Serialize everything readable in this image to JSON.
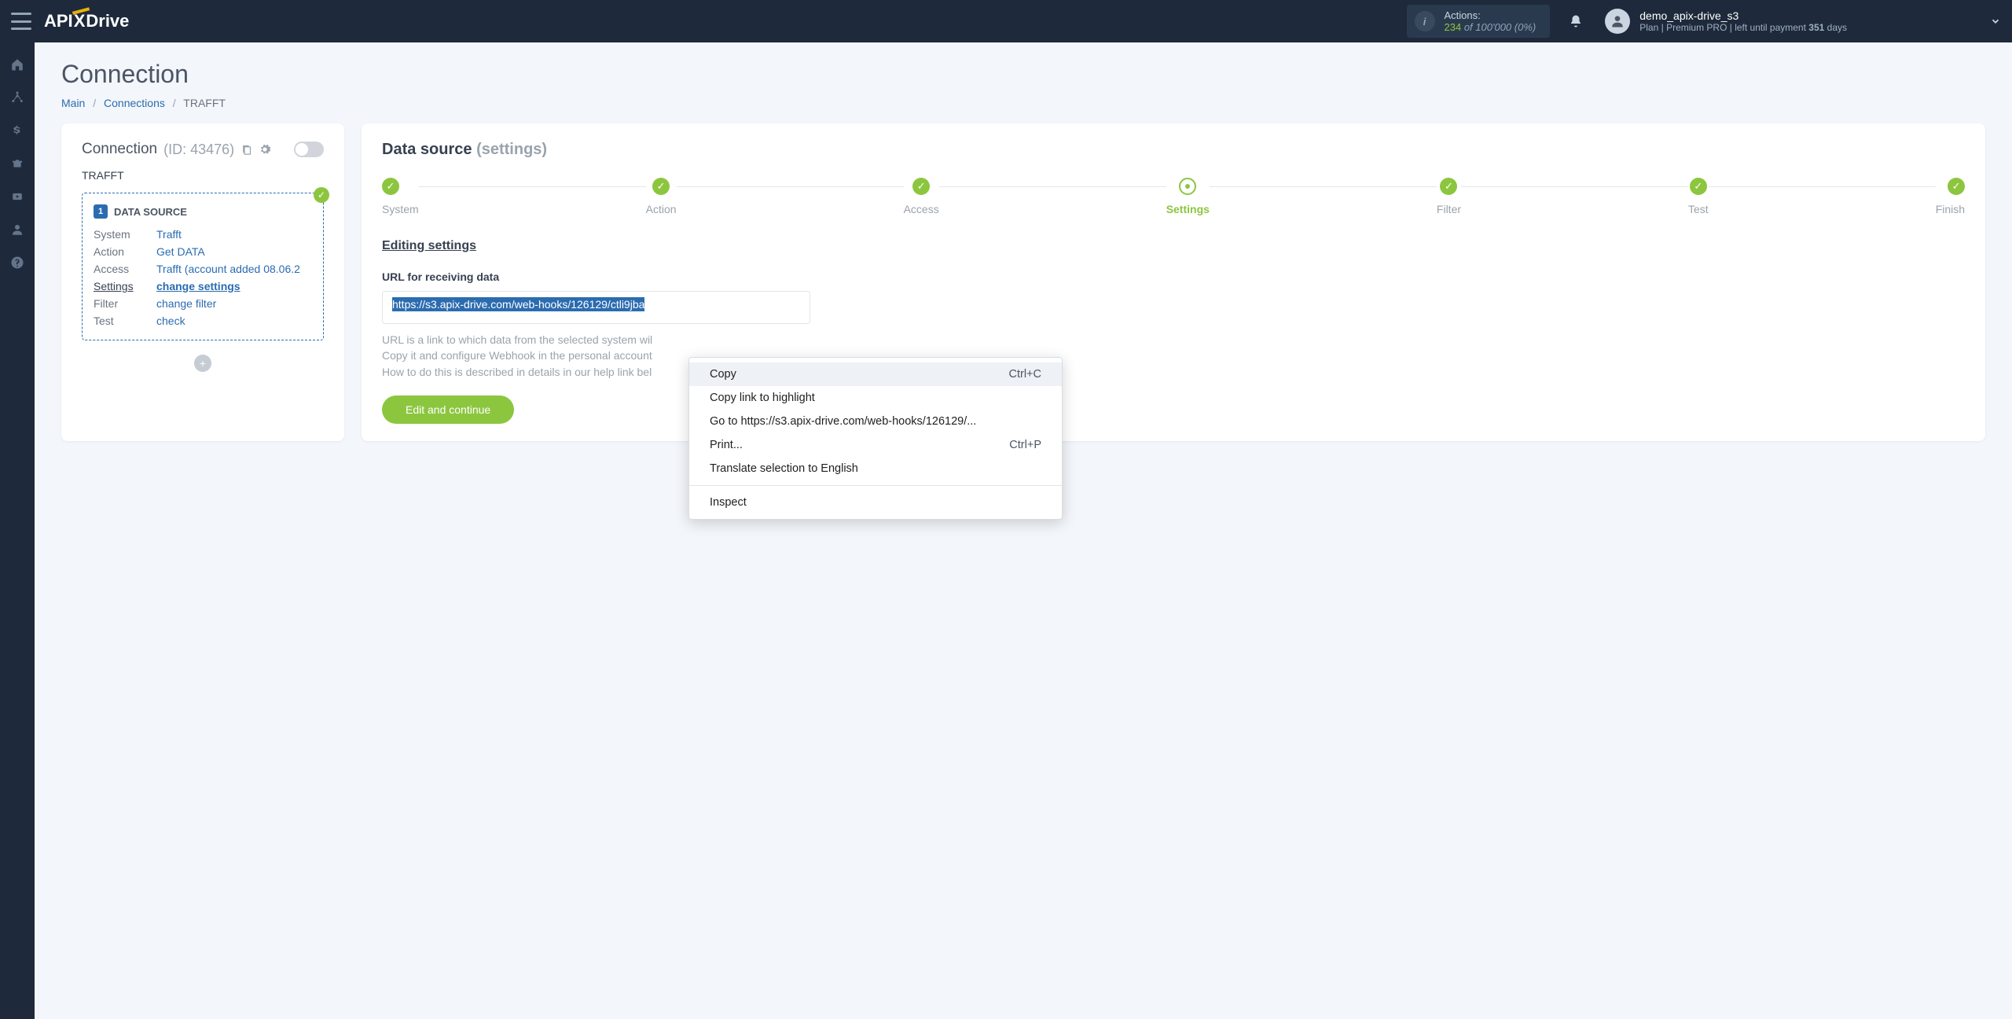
{
  "topbar": {
    "logo_a": "API",
    "logo_b": "Drive",
    "actions_label": "Actions:",
    "actions_used": "234",
    "actions_of": "of",
    "actions_total": "100'000",
    "actions_pct": "(0%)",
    "user_name": "demo_apix-drive_s3",
    "plan_prefix": "Plan |",
    "plan_name": "Premium PRO",
    "plan_suffix": "| left until payment",
    "plan_days": "351",
    "plan_days_word": "days"
  },
  "page": {
    "title": "Connection",
    "breadcrumb": {
      "main": "Main",
      "connections": "Connections",
      "current": "TRAFFT"
    }
  },
  "left": {
    "header": "Connection",
    "id_label": "(ID: 43476)",
    "conn_name": "TRAFFT",
    "ds_badge": "1",
    "ds_title": "DATA SOURCE",
    "rows": {
      "system_l": "System",
      "system_v": "Trafft",
      "action_l": "Action",
      "action_v": "Get DATA",
      "access_l": "Access",
      "access_v": "Trafft (account added 08.06.2",
      "settings_l": "Settings",
      "settings_v": "change settings",
      "filter_l": "Filter",
      "filter_v": "change filter",
      "test_l": "Test",
      "test_v": "check"
    }
  },
  "right": {
    "title": "Data source",
    "title_sub": "(settings)",
    "steps": [
      "System",
      "Action",
      "Access",
      "Settings",
      "Filter",
      "Test",
      "Finish"
    ],
    "section_title": "Editing settings",
    "field_label": "URL for receiving data",
    "url_value": "https://s3.apix-drive.com/web-hooks/126129/ctli9jba",
    "help1": "URL is a link to which data from the selected system wil",
    "help2": "Copy it and configure Webhook in the personal account",
    "help3": "How to do this is described in details in our help link bel",
    "button": "Edit and continue"
  },
  "ctx": {
    "copy": "Copy",
    "copy_sc": "Ctrl+C",
    "highlight": "Copy link to highlight",
    "goto": "Go to https://s3.apix-drive.com/web-hooks/126129/...",
    "print": "Print...",
    "print_sc": "Ctrl+P",
    "translate": "Translate selection to English",
    "inspect": "Inspect"
  }
}
